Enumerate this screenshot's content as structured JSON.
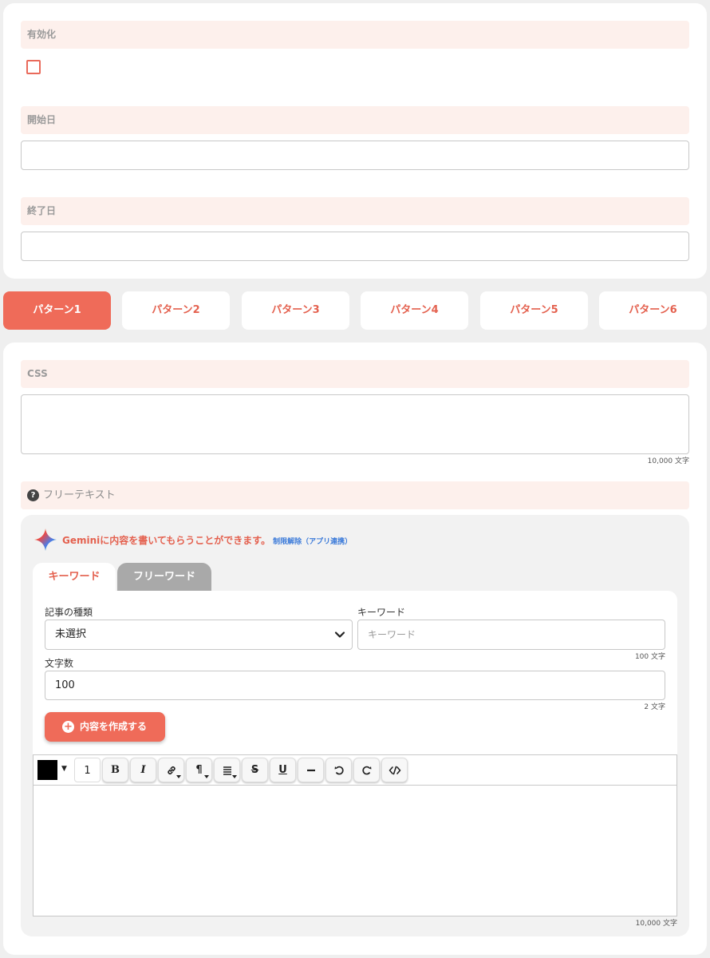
{
  "settings": {
    "enabled_label": "有効化",
    "enabled_checked": false,
    "start_date_label": "開始日",
    "start_date_value": "",
    "end_date_label": "終了日",
    "end_date_value": ""
  },
  "patterns": {
    "tabs": [
      "パターン1",
      "パターン2",
      "パターン3",
      "パターン4",
      "パターン5",
      "パターン6"
    ],
    "active_index": 0
  },
  "css_field": {
    "label": "CSS",
    "value": "",
    "counter": "10,000 文字"
  },
  "free_text": {
    "label": "フリーテキスト",
    "help_icon": "question-circle-icon"
  },
  "gemini": {
    "message": "Geminiに内容を書いてもらうことができます。",
    "link": "制限解除（アプリ連携）",
    "tabs": {
      "keyword": "キーワード",
      "freeword": "フリーワード"
    },
    "article_type_label": "記事の種類",
    "article_type_value": "未選択",
    "keyword_label": "キーワード",
    "keyword_placeholder": "キーワード",
    "keyword_counter": "100 文字",
    "char_count_label": "文字数",
    "char_count_value": "100",
    "char_count_counter": "2 文字",
    "create_button": "内容を作成する"
  },
  "editor": {
    "font_size": "1",
    "text_color": "#000000",
    "toolbar_icons": [
      "bold-icon",
      "italic-icon",
      "link-icon",
      "paragraph-icon",
      "align-icon",
      "strikethrough-icon",
      "underline-icon",
      "horizontal-rule-icon",
      "undo-icon",
      "redo-icon",
      "code-icon"
    ],
    "counter": "10,000 文字"
  },
  "colors": {
    "accent": "#ef6b59",
    "label_bg": "#fdf0ec",
    "link": "#3b7ad9"
  }
}
